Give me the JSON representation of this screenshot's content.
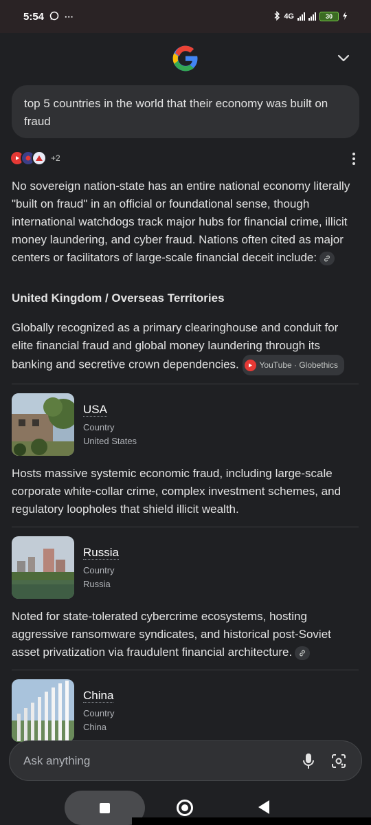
{
  "status_bar": {
    "time": "5:54",
    "extra": "···",
    "network": "4G",
    "battery": "30"
  },
  "query": {
    "text": "top 5 countries in the world that their economy was built on fraud"
  },
  "sources": {
    "more_count": "+2"
  },
  "answer": {
    "intro": "No sovereign nation-state has an entire national economy literally \"built on fraud\" in an official or foundational sense, though international watchdogs track major hubs for financial crime, illicit money laundering, and cyber fraud. Nations often cited as major centers or facilitators of large-scale financial deceit include:",
    "section_title": "United Kingdom / Overseas Territories",
    "section_text": "Globally recognized as a primary clearinghouse and conduit for elite financial fraud and global money laundering through its banking and secretive crown dependencies.",
    "section_source": "YouTube · Globethics",
    "entities": [
      {
        "name": "USA",
        "type": "Country",
        "sub": "United States",
        "text": "Hosts massive systemic economic fraud, including large-scale corporate white-collar crime, complex investment schemes, and regulatory loopholes that shield illicit wealth."
      },
      {
        "name": "Russia",
        "type": "Country",
        "sub": "Russia",
        "text": "Noted for state-tolerated cybercrime ecosystems, hosting aggressive ransomware syndicates, and historical post-Soviet asset privatization via fraudulent financial architecture."
      },
      {
        "name": "China",
        "type": "Country",
        "sub": "China"
      }
    ]
  },
  "ask_bar": {
    "placeholder": "Ask anything"
  },
  "colors": {
    "background": "#1f2023",
    "bubble": "#303134",
    "text": "#e3e3e3",
    "google_blue": "#4285F4",
    "google_red": "#EA4335",
    "google_yellow": "#FBBC05",
    "google_green": "#34A853"
  }
}
